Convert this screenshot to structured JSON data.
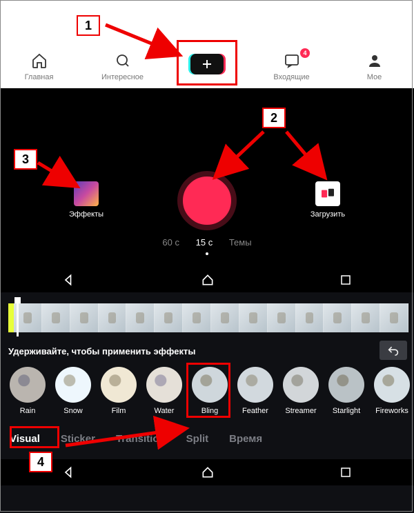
{
  "callouts": {
    "c1": "1",
    "c2": "2",
    "c3": "3",
    "c4": "4"
  },
  "nav": {
    "home": "Главная",
    "discover": "Интересное",
    "inbox": "Входящие",
    "inbox_badge": "4",
    "me": "Мое"
  },
  "record": {
    "effects": "Эффекты",
    "upload": "Загрузить",
    "dur60": "60 с",
    "dur15": "15 с",
    "durThemes": "Темы"
  },
  "editor": {
    "hint": "Удерживайте, чтобы применить эффекты",
    "fx": [
      "Rain",
      "Snow",
      "Film",
      "Water",
      "Bling",
      "Feather",
      "Streamer",
      "Starlight",
      "Fireworks"
    ],
    "tabs": {
      "visual": "Visual",
      "sticker": "Sticker",
      "transition": "Transition",
      "split": "Split",
      "time": "Время"
    }
  }
}
